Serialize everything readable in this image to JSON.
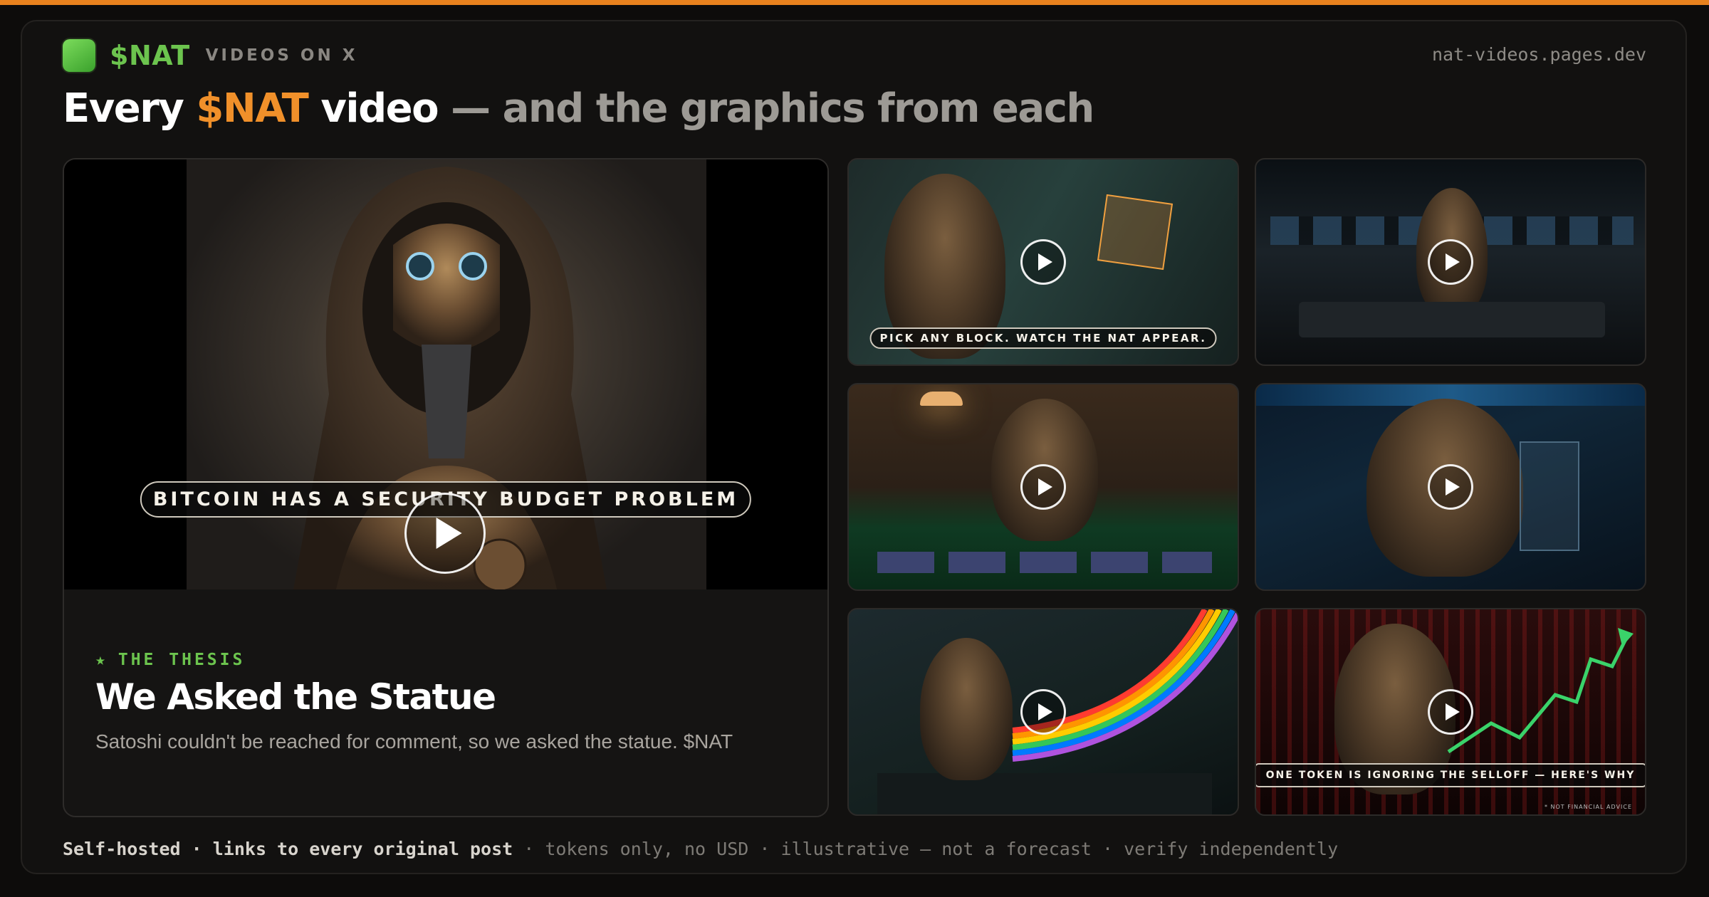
{
  "header": {
    "brand": "$NAT",
    "subtitle": "VIDEOS ON X",
    "site_url": "nat-videos.pages.dev"
  },
  "headline": {
    "part1": "Every ",
    "part2": "$NAT",
    "part3": " video",
    "part4": " — and the graphics from each"
  },
  "featured": {
    "caption": "BITCOIN HAS A SECURITY BUDGET PROBLEM",
    "tag": "THE THESIS",
    "tag_icon": "star-icon",
    "title": "We Asked the Statue",
    "description": "Satoshi couldn't be reached for comment, so we asked the statue. $NAT"
  },
  "thumbnails": [
    {
      "caption": "PICK ANY BLOCK. WATCH THE NAT APPEAR.",
      "scene": "hologram-bitcoin-cube"
    },
    {
      "caption": "",
      "scene": "newsroom-desk"
    },
    {
      "caption": "",
      "scene": "poker-table"
    },
    {
      "caption": "",
      "scene": "ticker-lobby"
    },
    {
      "caption": "",
      "scene": "rainbow-desk"
    },
    {
      "caption": "ONE TOKEN IS IGNORING THE SELLOFF — HERE'S WHY",
      "disclaimer": "* NOT FINANCIAL ADVICE",
      "scene": "market-chart"
    }
  ],
  "footer": {
    "bold1": "Self-hosted",
    "sep1": " · ",
    "bold2": "links to every original post",
    "rest": " · tokens only, no USD · illustrative — not a forecast · verify independently"
  },
  "colors": {
    "accent_orange": "#e8821e",
    "brand_green": "#6cc44e",
    "background": "#0d0c0b"
  }
}
